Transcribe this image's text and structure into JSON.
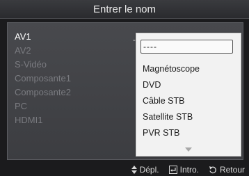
{
  "title": "Entrer le nom",
  "sources": [
    {
      "label": "AV1",
      "active": true
    },
    {
      "label": "AV2",
      "active": false
    },
    {
      "label": "S-Vidéo",
      "active": false
    },
    {
      "label": "Composante1",
      "active": false
    },
    {
      "label": "Composante2",
      "active": false
    },
    {
      "label": "PC",
      "active": false
    },
    {
      "label": "HDMI1",
      "active": false
    }
  ],
  "current_marker": "-",
  "dropdown": {
    "selected": "----",
    "options": [
      "Magnétoscope",
      "DVD",
      "Câble STB",
      "Satellite STB",
      "PVR STB"
    ]
  },
  "footer": {
    "move": {
      "icon": "up-down-arrows-icon",
      "label": "Dépl."
    },
    "enter": {
      "icon": "enter-icon",
      "label": "Intro."
    },
    "back": {
      "icon": "return-icon",
      "label": "Retour"
    }
  }
}
